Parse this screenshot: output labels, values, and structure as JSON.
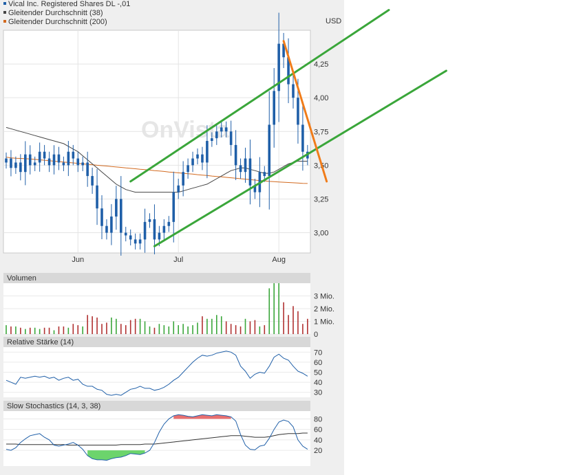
{
  "chart_data": {
    "type": "candlestick",
    "currency": "USD",
    "legend": [
      {
        "name": "Vical Inc. Registered Shares DL -,01",
        "color": "#1f5fa8"
      },
      {
        "name": "Gleitender Durchschnitt (38)",
        "color": "#444444"
      },
      {
        "name": "Gleitender Durchschnitt (200)",
        "color": "#d2691e"
      }
    ],
    "watermark": "OnVista",
    "price": {
      "ylim": [
        2.85,
        4.5
      ],
      "yticks": [
        "4,25",
        "4,00",
        "3,75",
        "3,50",
        "3,25",
        "3,00"
      ],
      "ytick_values": [
        4.25,
        4.0,
        3.75,
        3.5,
        3.25,
        3.0
      ],
      "xticks": [
        {
          "label": "Jun",
          "i": 15
        },
        {
          "label": "Jul",
          "i": 36
        },
        {
          "label": "Aug",
          "i": 57
        }
      ],
      "n": 64,
      "closes": [
        3.55,
        3.48,
        3.52,
        3.45,
        3.58,
        3.5,
        3.52,
        3.6,
        3.55,
        3.5,
        3.58,
        3.52,
        3.5,
        3.6,
        3.55,
        3.5,
        3.52,
        3.42,
        3.35,
        3.18,
        3.05,
        3.0,
        3.12,
        3.25,
        3.0,
        2.98,
        2.95,
        2.92,
        2.95,
        3.08,
        3.1,
        2.95,
        3.0,
        3.05,
        3.08,
        3.3,
        3.35,
        3.45,
        3.5,
        3.55,
        3.58,
        3.52,
        3.68,
        3.7,
        3.75,
        3.78,
        3.75,
        3.65,
        3.5,
        3.45,
        3.55,
        3.35,
        3.3,
        3.45,
        3.42,
        3.8,
        4.05,
        4.4,
        4.3,
        4.1,
        4.0,
        3.8,
        3.6,
        3.55
      ],
      "ma38": [
        3.78,
        3.77,
        3.76,
        3.75,
        3.74,
        3.73,
        3.72,
        3.71,
        3.7,
        3.69,
        3.68,
        3.67,
        3.66,
        3.64,
        3.62,
        3.6,
        3.57,
        3.54,
        3.51,
        3.48,
        3.45,
        3.42,
        3.39,
        3.36,
        3.34,
        3.32,
        3.31,
        3.3,
        3.3,
        3.3,
        3.3,
        3.3,
        3.3,
        3.3,
        3.3,
        3.3,
        3.3,
        3.31,
        3.32,
        3.33,
        3.34,
        3.35,
        3.36,
        3.38,
        3.4,
        3.42,
        3.44,
        3.46,
        3.47,
        3.48,
        3.48,
        3.47,
        3.46,
        3.45,
        3.44,
        3.44,
        3.45,
        3.47,
        3.49,
        3.51,
        3.52,
        3.53,
        3.53,
        3.53
      ],
      "ma200": [
        3.56,
        3.555,
        3.552,
        3.55,
        3.548,
        3.546,
        3.544,
        3.54,
        3.537,
        3.534,
        3.53,
        3.527,
        3.524,
        3.52,
        3.517,
        3.514,
        3.51,
        3.507,
        3.504,
        3.5,
        3.497,
        3.494,
        3.49,
        3.487,
        3.484,
        3.48,
        3.477,
        3.474,
        3.47,
        3.467,
        3.464,
        3.46,
        3.457,
        3.454,
        3.45,
        3.447,
        3.444,
        3.44,
        3.437,
        3.434,
        3.43,
        3.427,
        3.424,
        3.42,
        3.417,
        3.414,
        3.41,
        3.407,
        3.404,
        3.4,
        3.397,
        3.394,
        3.39,
        3.387,
        3.384,
        3.38,
        3.378,
        3.376,
        3.374,
        3.372,
        3.37,
        3.368,
        3.366,
        3.365
      ],
      "trendlines": [
        {
          "color": "#3aa63a",
          "from": {
            "i": 26,
            "v": 3.38
          },
          "to": {
            "i": 80,
            "v": 4.65
          }
        },
        {
          "color": "#3aa63a",
          "from": {
            "i": 31,
            "v": 2.9
          },
          "to": {
            "i": 92,
            "v": 4.2
          }
        },
        {
          "color": "#f07c1a",
          "from": {
            "i": 58,
            "v": 4.42
          },
          "to": {
            "i": 67,
            "v": 3.38
          }
        }
      ]
    },
    "volume": {
      "title": "Volumen",
      "yticks": [
        "3 Mio.",
        "2 Mio.",
        "1 Mio.",
        "0"
      ],
      "ytick_values": [
        3,
        2,
        1,
        0
      ],
      "ylim": [
        0,
        4.0
      ],
      "values": [
        0.7,
        0.6,
        0.6,
        0.5,
        0.4,
        0.5,
        0.5,
        0.4,
        0.5,
        0.5,
        0.3,
        0.6,
        0.6,
        0.5,
        0.8,
        0.7,
        0.6,
        1.5,
        1.4,
        1.3,
        0.8,
        0.9,
        1.3,
        1.2,
        0.8,
        0.7,
        1.1,
        1.2,
        1.2,
        1.0,
        0.6,
        0.5,
        0.8,
        0.7,
        0.6,
        1.0,
        0.7,
        0.8,
        0.6,
        0.7,
        0.9,
        1.4,
        1.2,
        1.2,
        1.5,
        1.4,
        1.0,
        0.8,
        0.7,
        0.6,
        1.2,
        1.0,
        1.1,
        0.6,
        0.7,
        3.6,
        4.0,
        4.0,
        2.5,
        1.5,
        2.2,
        1.8,
        0.8,
        1.2
      ],
      "colors_up_down": [
        "#3aa63a",
        "#b03030"
      ]
    },
    "rsi": {
      "title": "Relative Stärke (14)",
      "yticks": [
        "70",
        "60",
        "50",
        "40",
        "30"
      ],
      "ytick_values": [
        70,
        60,
        50,
        40,
        30
      ],
      "ylim": [
        25,
        75
      ],
      "values": [
        42,
        40,
        38,
        45,
        44,
        45,
        46,
        45,
        46,
        44,
        45,
        42,
        44,
        45,
        42,
        43,
        38,
        36,
        36,
        33,
        32,
        28,
        27,
        28,
        27,
        30,
        33,
        34,
        36,
        34,
        34,
        32,
        33,
        35,
        38,
        42,
        45,
        50,
        55,
        60,
        64,
        67,
        66,
        67,
        69,
        70,
        71,
        70,
        67,
        56,
        51,
        44,
        48,
        50,
        49,
        56,
        65,
        68,
        64,
        62,
        56,
        51,
        49,
        46
      ]
    },
    "stochastics": {
      "title": "Slow Stochastics (14, 3, 38)",
      "yticks": [
        "80",
        "60",
        "40",
        "20"
      ],
      "ytick_values": [
        80,
        60,
        40,
        20
      ],
      "ylim": [
        -10,
        95
      ],
      "k": [
        22,
        20,
        25,
        35,
        42,
        48,
        50,
        52,
        45,
        40,
        30,
        28,
        30,
        32,
        35,
        30,
        22,
        10,
        4,
        2,
        2,
        1,
        4,
        6,
        7,
        10,
        14,
        13,
        12,
        15,
        20,
        35,
        55,
        70,
        80,
        86,
        88,
        87,
        85,
        84,
        86,
        88,
        87,
        86,
        88,
        87,
        86,
        84,
        76,
        50,
        30,
        22,
        21,
        28,
        30,
        43,
        60,
        74,
        78,
        75,
        65,
        40,
        28,
        22
      ],
      "d": [
        32,
        32,
        32,
        31,
        31,
        31,
        31,
        31,
        31,
        31,
        31,
        31,
        31,
        30,
        30,
        30,
        30,
        30,
        30,
        30,
        30,
        30,
        30,
        30,
        31,
        31,
        31,
        31,
        31,
        32,
        32,
        32,
        33,
        34,
        35,
        36,
        37,
        38,
        39,
        40,
        41,
        42,
        43,
        44,
        45,
        46,
        47,
        48,
        48,
        48,
        47,
        46,
        45,
        45,
        45,
        46,
        48,
        50,
        51,
        52,
        52,
        52,
        53,
        53
      ],
      "overbought": 80,
      "oversold": 20,
      "overbought_color": "#e87070",
      "oversold_color": "#6cd46c"
    }
  }
}
